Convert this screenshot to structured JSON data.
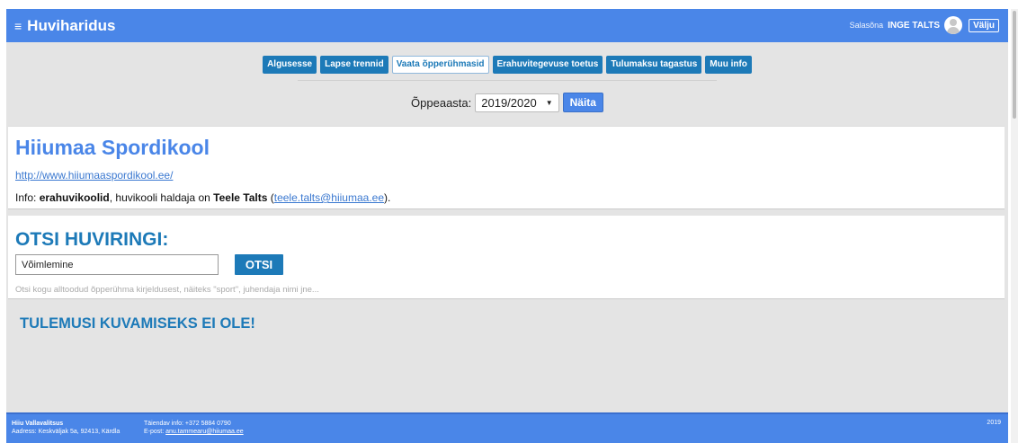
{
  "app": {
    "title": "Huviharidus",
    "menu_icon": "hamburger-icon",
    "user_prefix": "Salasõna",
    "user_name": "INGE TALTS",
    "avatar_icon": "user-avatar-icon",
    "logout_label": "Välju"
  },
  "nav": {
    "items": [
      {
        "label": "Algusesse"
      },
      {
        "label": "Lapse trennid"
      },
      {
        "label": "Vaata õpperühmasid"
      },
      {
        "label": "Erahuvitegevuse toetus"
      },
      {
        "label": "Tulumaksu tagastus"
      },
      {
        "label": "Muu info"
      }
    ],
    "active": "Vaata õpperühmasid"
  },
  "year_filter": {
    "label": "Õppeaasta:",
    "selected": "2019/2020",
    "dropdown_icon": "caret-down-icon",
    "show_button": "Näita"
  },
  "school": {
    "title": "Hiiumaa Spordikool",
    "url": "http://www.hiiumaaspordikool.ee/",
    "info_prefix": "Info:",
    "info_type": "erahuvikoolid",
    "info_mid": ", huvikooli haldaja on",
    "manager": "Teele Talts",
    "email_open": "(",
    "email": "teele.talts@hiiumaa.ee",
    "email_close": ")."
  },
  "search": {
    "title": "OTSI HUVIRINGI:",
    "value": "Võimlemine",
    "button": "OTSI",
    "hint": "Otsi kogu alltoodud õpperühma kirjeldusest, näiteks \"sport\", juhendaja nimi jne..."
  },
  "results": {
    "empty_message": "TULEMUSI KUVAMISEKS EI OLE!"
  },
  "footer": {
    "org": "Hiiu Vallavalitsus",
    "address": "Aadress: Keskväljak 5a, 92413, Kärdla",
    "contact_info": "Täiendav info: +372 5884 0790",
    "email_label": "E-post:",
    "email": "anu.tammearu@hiiumaa.ee",
    "year": "2019"
  },
  "colors": {
    "primary": "#4a86e8",
    "nav_button": "#1d7ab8",
    "background": "#e4e4e4"
  }
}
